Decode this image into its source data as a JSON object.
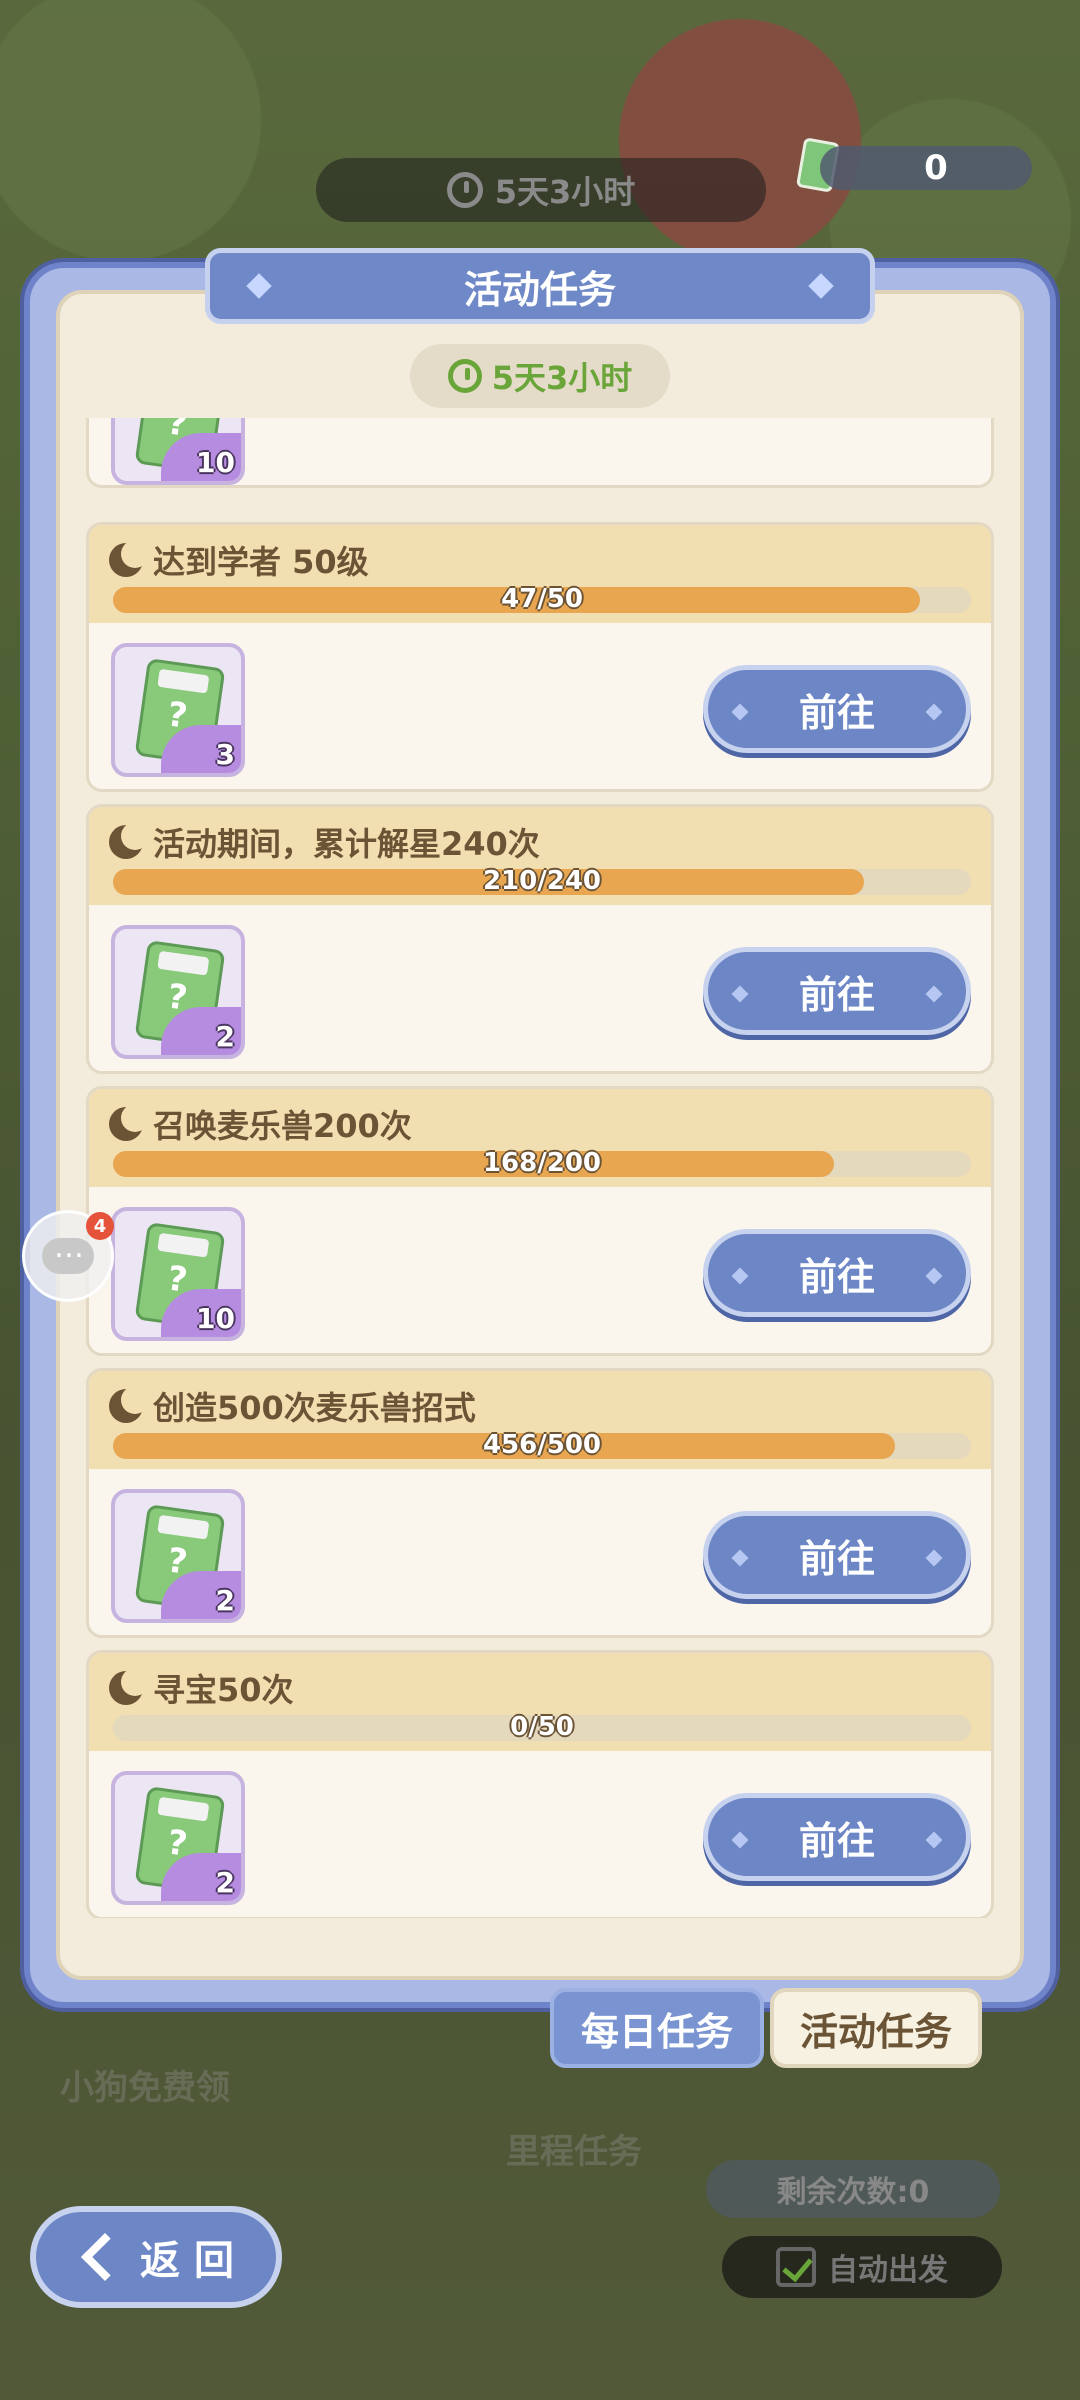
{
  "header": {
    "timer_text": "5天3小时",
    "currency_value": "0"
  },
  "panel": {
    "title": "活动任务",
    "timer_text": "5天3小时"
  },
  "tasks": [
    {
      "title": "",
      "progress_text": "",
      "progress": 0,
      "reward_count": "10",
      "button_label": ""
    },
    {
      "title": "达到学者 50级",
      "progress_text": "47/50",
      "progress": 0.94,
      "reward_count": "3",
      "button_label": "前往"
    },
    {
      "title": "活动期间，累计解星240次",
      "progress_text": "210/240",
      "progress": 0.875,
      "reward_count": "2",
      "button_label": "前往"
    },
    {
      "title": "召唤麦乐兽200次",
      "progress_text": "168/200",
      "progress": 0.84,
      "reward_count": "10",
      "button_label": "前往"
    },
    {
      "title": "创造500次麦乐兽招式",
      "progress_text": "456/500",
      "progress": 0.912,
      "reward_count": "2",
      "button_label": "前往"
    },
    {
      "title": "寻宝50次",
      "progress_text": "0/50",
      "progress": 0,
      "reward_count": "2",
      "button_label": "前往"
    }
  ],
  "chat": {
    "badge": "4"
  },
  "tabs": {
    "daily": "每日任务",
    "event": "活动任务"
  },
  "bottom": {
    "back_label": "返 回",
    "remaining": "剩余次数:0",
    "auto_label": "自动出发",
    "bg_left": "小狗免费领",
    "bg_center": "里程任务"
  }
}
